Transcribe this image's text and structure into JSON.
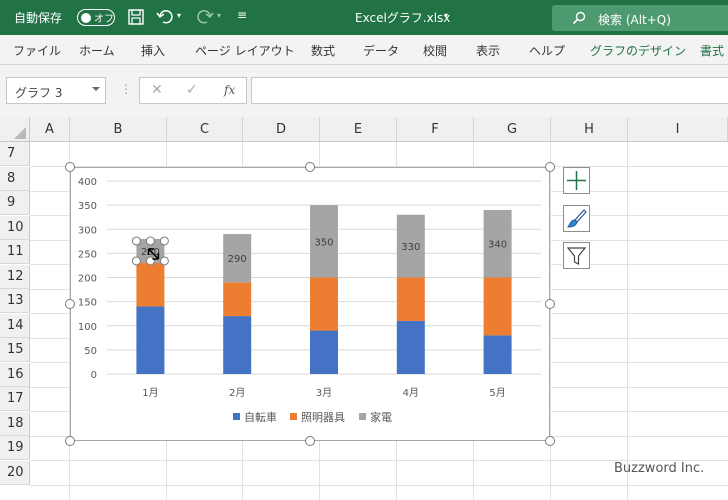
{
  "titlebar": {
    "autosave_label": "自動保存",
    "autosave_state": "オフ",
    "filename": "Excelグラフ.xlsx",
    "search_label": "検索 (Alt+Q)"
  },
  "ribbon": {
    "tabs": [
      "ファイル",
      "ホーム",
      "挿入",
      "ページ レイアウト",
      "数式",
      "データ",
      "校閲",
      "表示",
      "ヘルプ",
      "グラフのデザイン",
      "書式"
    ]
  },
  "formula_bar": {
    "name_box": "グラフ 3",
    "fx": "fx",
    "formula": ""
  },
  "grid": {
    "columns": [
      "A",
      "B",
      "C",
      "D",
      "E",
      "F",
      "G",
      "H",
      "I"
    ],
    "rows": [
      "7",
      "8",
      "9",
      "10",
      "11",
      "12",
      "13",
      "14",
      "15",
      "16",
      "17",
      "18",
      "19",
      "20"
    ]
  },
  "chart_data": {
    "type": "bar",
    "stacked": true,
    "categories": [
      "1月",
      "2月",
      "3月",
      "4月",
      "5月"
    ],
    "series": [
      {
        "name": "自転車",
        "color": "#4472c4",
        "values": [
          140,
          120,
          90,
          110,
          80
        ]
      },
      {
        "name": "照明器具",
        "color": "#ed7d31",
        "values": [
          90,
          70,
          110,
          90,
          120
        ]
      },
      {
        "name": "家電",
        "color": "#a5a5a5",
        "values": [
          50,
          100,
          150,
          130,
          140
        ]
      }
    ],
    "data_labels": {
      "series": "家電",
      "values": [
        280,
        290,
        350,
        330,
        340
      ]
    },
    "yticks": [
      "0",
      "50",
      "100",
      "150",
      "200",
      "250",
      "300",
      "350",
      "400"
    ],
    "ylim": [
      0,
      400
    ],
    "grid": true,
    "legend": "bottom",
    "title": "",
    "xlabel": "",
    "ylabel": ""
  },
  "chart_tools": [
    "chart-elements-button",
    "chart-styles-button",
    "chart-filters-button"
  ],
  "watermark": "Buzzword Inc."
}
